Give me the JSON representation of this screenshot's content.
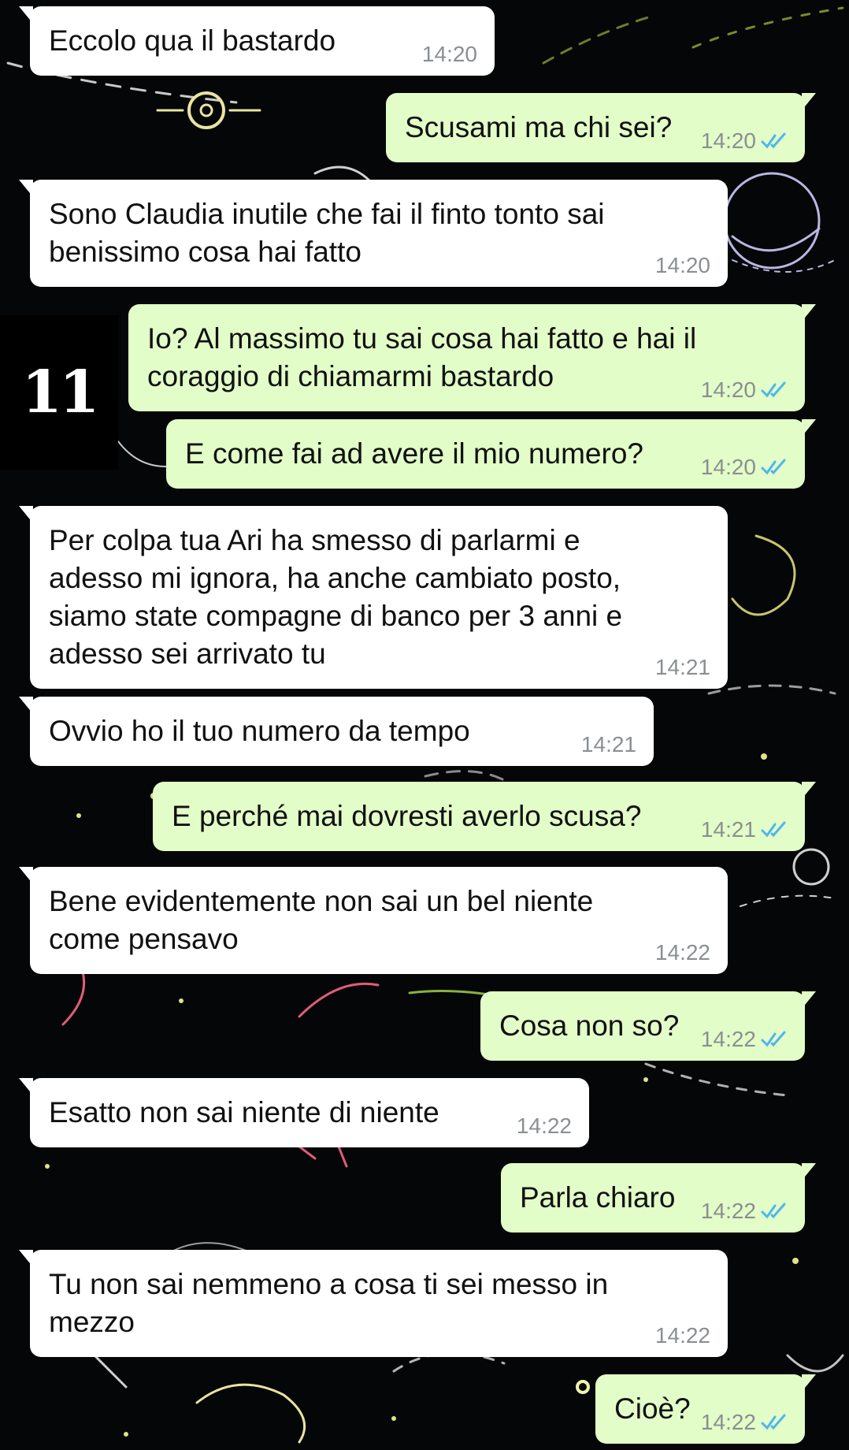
{
  "colors": {
    "incoming_bubble": "#ffffff",
    "outgoing_bubble": "#e2fdc8",
    "read_ticks": "#4fb6ec",
    "timestamp": "#8a8f92",
    "background": "#050607"
  },
  "badge": {
    "label": "11"
  },
  "messages": [
    {
      "direction": "in",
      "text": "Eccolo qua il bastardo",
      "time": "14:20"
    },
    {
      "direction": "out",
      "text": "Scusami ma chi sei?",
      "time": "14:20",
      "status_icon": "double-check-read-icon"
    },
    {
      "direction": "in",
      "text": "Sono Claudia inutile che fai il finto tonto sai\nbenissimo cosa hai fatto",
      "time": "14:20"
    },
    {
      "direction": "out",
      "text": "Io? Al massimo tu sai cosa hai fatto e hai il\ncoraggio di chiamarmi bastardo",
      "time": "14:20",
      "status_icon": "double-check-read-icon"
    },
    {
      "direction": "out",
      "text": "E come fai ad avere il mio numero?",
      "time": "14:20",
      "status_icon": "double-check-read-icon"
    },
    {
      "direction": "in",
      "text": "Per colpa tua Ari ha smesso di parlarmi e\nadesso mi ignora, ha anche cambiato posto,\nsiamo state compagne di banco per 3 anni e\nadesso sei arrivato tu",
      "time": "14:21"
    },
    {
      "direction": "in",
      "text": "Ovvio ho il tuo numero da tempo",
      "time": "14:21"
    },
    {
      "direction": "out",
      "text": "E perché mai dovresti averlo scusa?",
      "time": "14:21",
      "status_icon": "double-check-read-icon"
    },
    {
      "direction": "in",
      "text": "Bene evidentemente non sai un bel niente\ncome pensavo",
      "time": "14:22"
    },
    {
      "direction": "out",
      "text": "Cosa non so?",
      "time": "14:22",
      "status_icon": "double-check-read-icon"
    },
    {
      "direction": "in",
      "text": "Esatto non sai niente di niente",
      "time": "14:22"
    },
    {
      "direction": "out",
      "text": "Parla chiaro",
      "time": "14:22",
      "status_icon": "double-check-read-icon"
    },
    {
      "direction": "in",
      "text": "Tu non sai nemmeno a cosa ti sei messo in\nmezzo",
      "time": "14:22"
    },
    {
      "direction": "out",
      "text": "Cioè?",
      "time": "14:22",
      "status_icon": "double-check-read-icon"
    }
  ]
}
